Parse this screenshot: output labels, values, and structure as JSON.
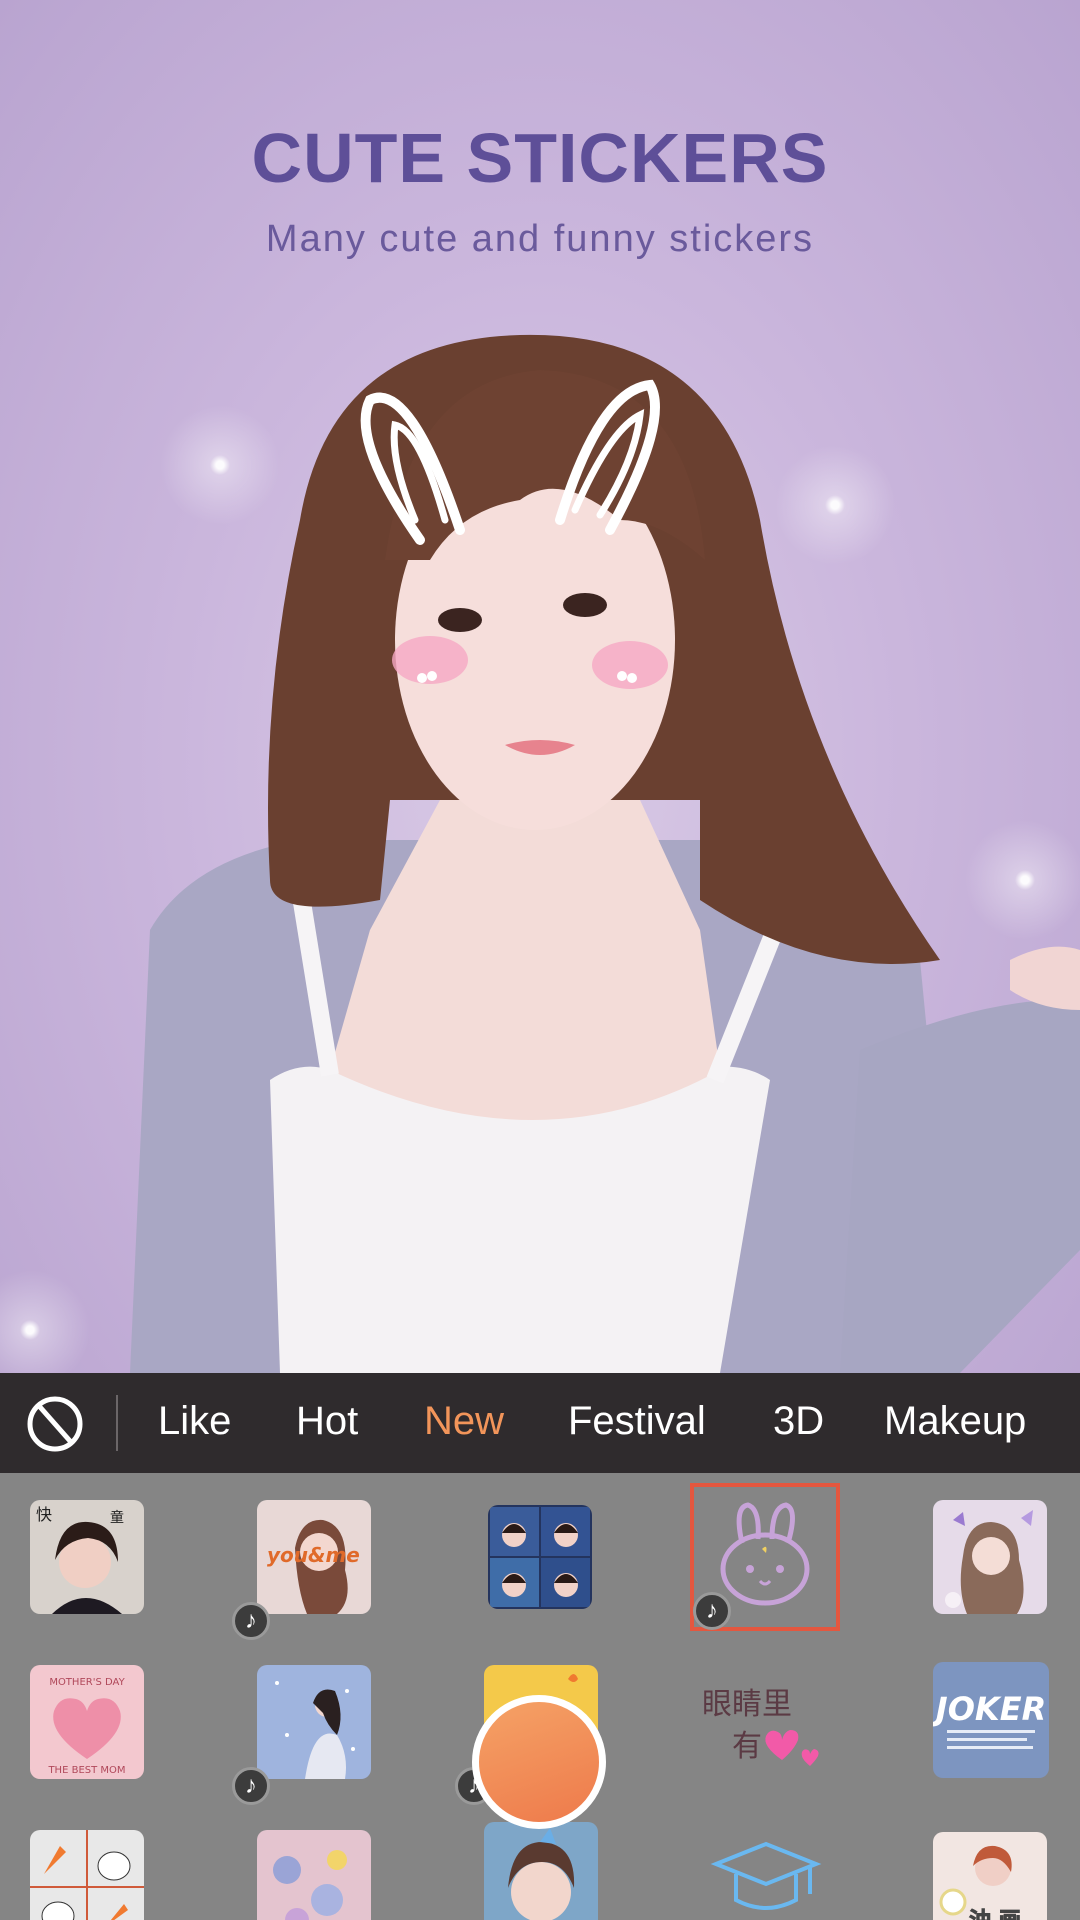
{
  "hero": {
    "title": "CUTE STICKERS",
    "subtitle": "Many cute and funny stickers"
  },
  "category_bar": {
    "tabs": [
      {
        "label": "Like"
      },
      {
        "label": "Hot"
      },
      {
        "label": "New",
        "active": true
      },
      {
        "label": "Festival"
      },
      {
        "label": "3D"
      },
      {
        "label": "Makeup"
      }
    ],
    "active_color": "#f2955a"
  },
  "stickers": {
    "row1": [
      {
        "icon": "collage-portrait-sticker",
        "music": false
      },
      {
        "icon": "youandme-portrait-sticker",
        "label": "you&me",
        "music": true
      },
      {
        "icon": "four-grid-faces-sticker",
        "music": false
      },
      {
        "icon": "bunny-face-sticker",
        "music": true,
        "selected": true
      },
      {
        "icon": "butterfly-portrait-sticker",
        "music": false
      }
    ],
    "row2": [
      {
        "icon": "mothers-day-heart-sticker",
        "top_text": "MOTHER'S DAY",
        "bottom_text": "THE BEST MOM",
        "music": false
      },
      {
        "icon": "starry-girl-sticker",
        "music": true
      },
      {
        "icon": "orange-fruit-sticker",
        "music": true
      },
      {
        "icon": "eyes-heart-text-sticker",
        "text_line1": "眼睛里",
        "text_line2": "有",
        "music": false
      },
      {
        "icon": "joker-text-sticker",
        "label": "JOKER",
        "music": false
      }
    ],
    "row3": [
      {
        "icon": "carrot-bunny-sticker"
      },
      {
        "icon": "flower-frame-sticker"
      },
      {
        "icon": "butterfly-face-sticker"
      },
      {
        "icon": "graduation-cap-sticker"
      },
      {
        "icon": "oil-painting-sticker",
        "label": "油 画"
      }
    ]
  },
  "colors": {
    "title": "#5e4f98",
    "selected_border": "#e4573f",
    "shutter": "#ee7a4b"
  }
}
